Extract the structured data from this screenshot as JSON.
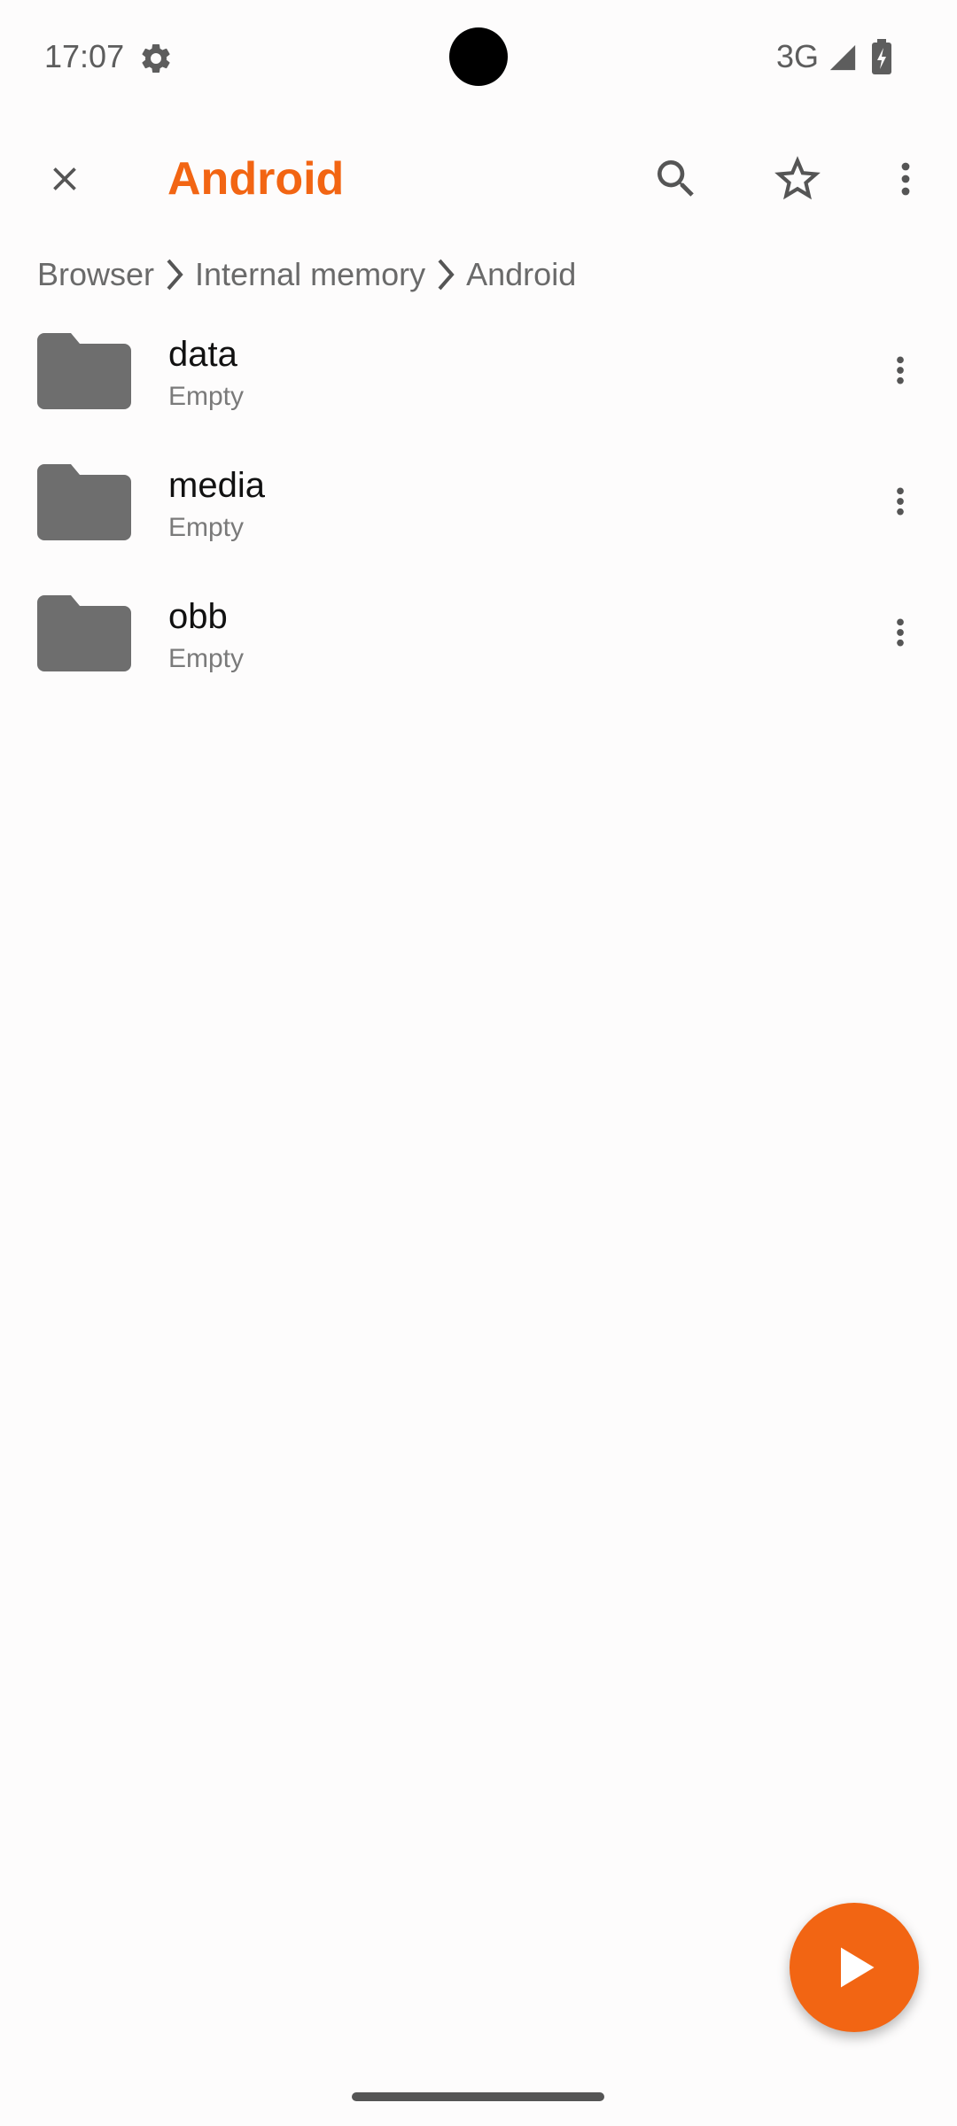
{
  "status_bar": {
    "time": "17:07",
    "network": "3G",
    "icons": [
      "settings-gear-icon",
      "cellular-signal-icon",
      "battery-charging-icon"
    ]
  },
  "toolbar": {
    "title": "Android",
    "icons": [
      "close-icon",
      "search-icon",
      "star-outline-icon",
      "more-vert-icon"
    ]
  },
  "breadcrumb": {
    "items": [
      "Browser",
      "Internal memory",
      "Android"
    ]
  },
  "files": [
    {
      "name": "data",
      "subtitle": "Empty",
      "icon": "folder-icon"
    },
    {
      "name": "media",
      "subtitle": "Empty",
      "icon": "folder-icon"
    },
    {
      "name": "obb",
      "subtitle": "Empty",
      "icon": "folder-icon"
    }
  ],
  "fab": {
    "icon": "play-icon"
  },
  "colors": {
    "accent": "#f26513",
    "icon_gray": "#6e6e6e",
    "background": "#fdfcfc"
  }
}
